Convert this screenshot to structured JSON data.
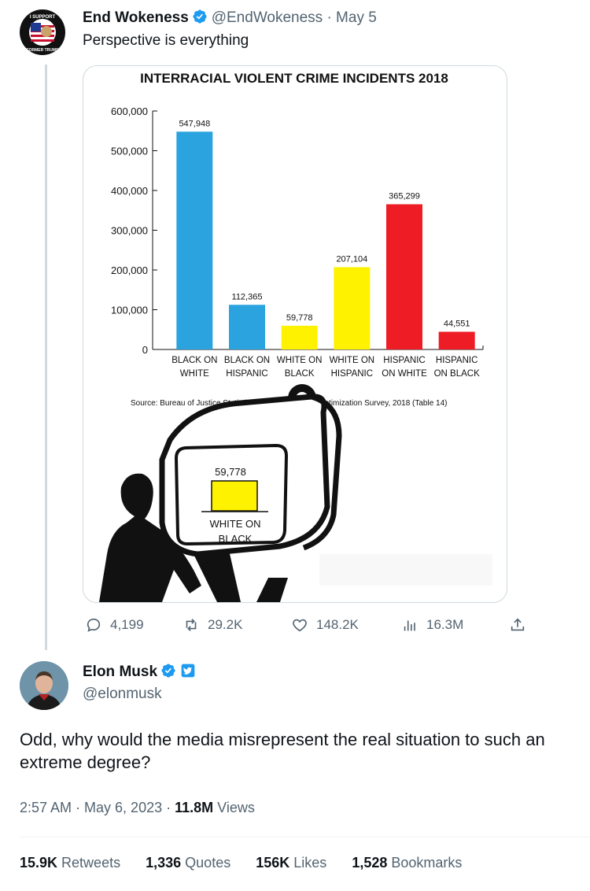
{
  "original_tweet": {
    "author_name": "End Wokeness",
    "handle_date": "@EndWokeness · May 5",
    "text": "Perspective is everything",
    "avatar_text_top": "I SUPPORT",
    "avatar_text_bottom": "FORMER TRUMP",
    "actions": {
      "replies": "4,199",
      "retweets": "29.2K",
      "likes": "148.2K",
      "views": "16.3M"
    }
  },
  "chart_data": {
    "type": "bar",
    "title": "INTERRACIAL VIOLENT CRIME INCIDENTS 2018",
    "categories": [
      [
        "BLACK ON",
        "WHITE"
      ],
      [
        "BLACK ON",
        "HISPANIC"
      ],
      [
        "WHITE ON",
        "BLACK"
      ],
      [
        "WHITE ON",
        "HISPANIC"
      ],
      [
        "HISPANIC",
        "ON WHITE"
      ],
      [
        "HISPANIC",
        "ON BLACK"
      ]
    ],
    "values": [
      547948,
      112365,
      59778,
      207104,
      365299,
      44551
    ],
    "value_labels": [
      "547,948",
      "112,365",
      "59,778",
      "207,104",
      "365,299",
      "44,551"
    ],
    "colors": [
      "#2aa3df",
      "#2aa3df",
      "#fff200",
      "#fff200",
      "#ee1c25",
      "#ee1c25"
    ],
    "ylim": [
      0,
      600000
    ],
    "yticks": [
      "0",
      "100,000",
      "200,000",
      "300,000",
      "400,000",
      "500,000",
      "600,000"
    ],
    "source_left": "Source: Bureau of Justice Statistics, Na",
    "source_right": "e Victimization Survey, 2018 (Table 14)"
  },
  "tv_screen": {
    "value": "59,778",
    "label_line1": "WHITE ON",
    "label_line2": "BLACK",
    "bar_color": "#fff200"
  },
  "reply": {
    "author_name": "Elon Musk",
    "handle": "@elonmusk",
    "text": "Odd, why would the media misrepresent the real situation to such an extreme degree?",
    "time": "2:57 AM · May 6, 2023 · ",
    "views_count": "11.8M",
    "views_label": " Views",
    "stats": {
      "retweets_count": "15.9K",
      "retweets_label": " Retweets",
      "quotes_count": "1,336",
      "quotes_label": " Quotes",
      "likes_count": "156K",
      "likes_label": " Likes",
      "bookmarks_count": "1,528",
      "bookmarks_label": " Bookmarks"
    }
  },
  "colors": {
    "verified": "#1d9bf0",
    "text": "#0f1419",
    "secondary": "#536471"
  }
}
